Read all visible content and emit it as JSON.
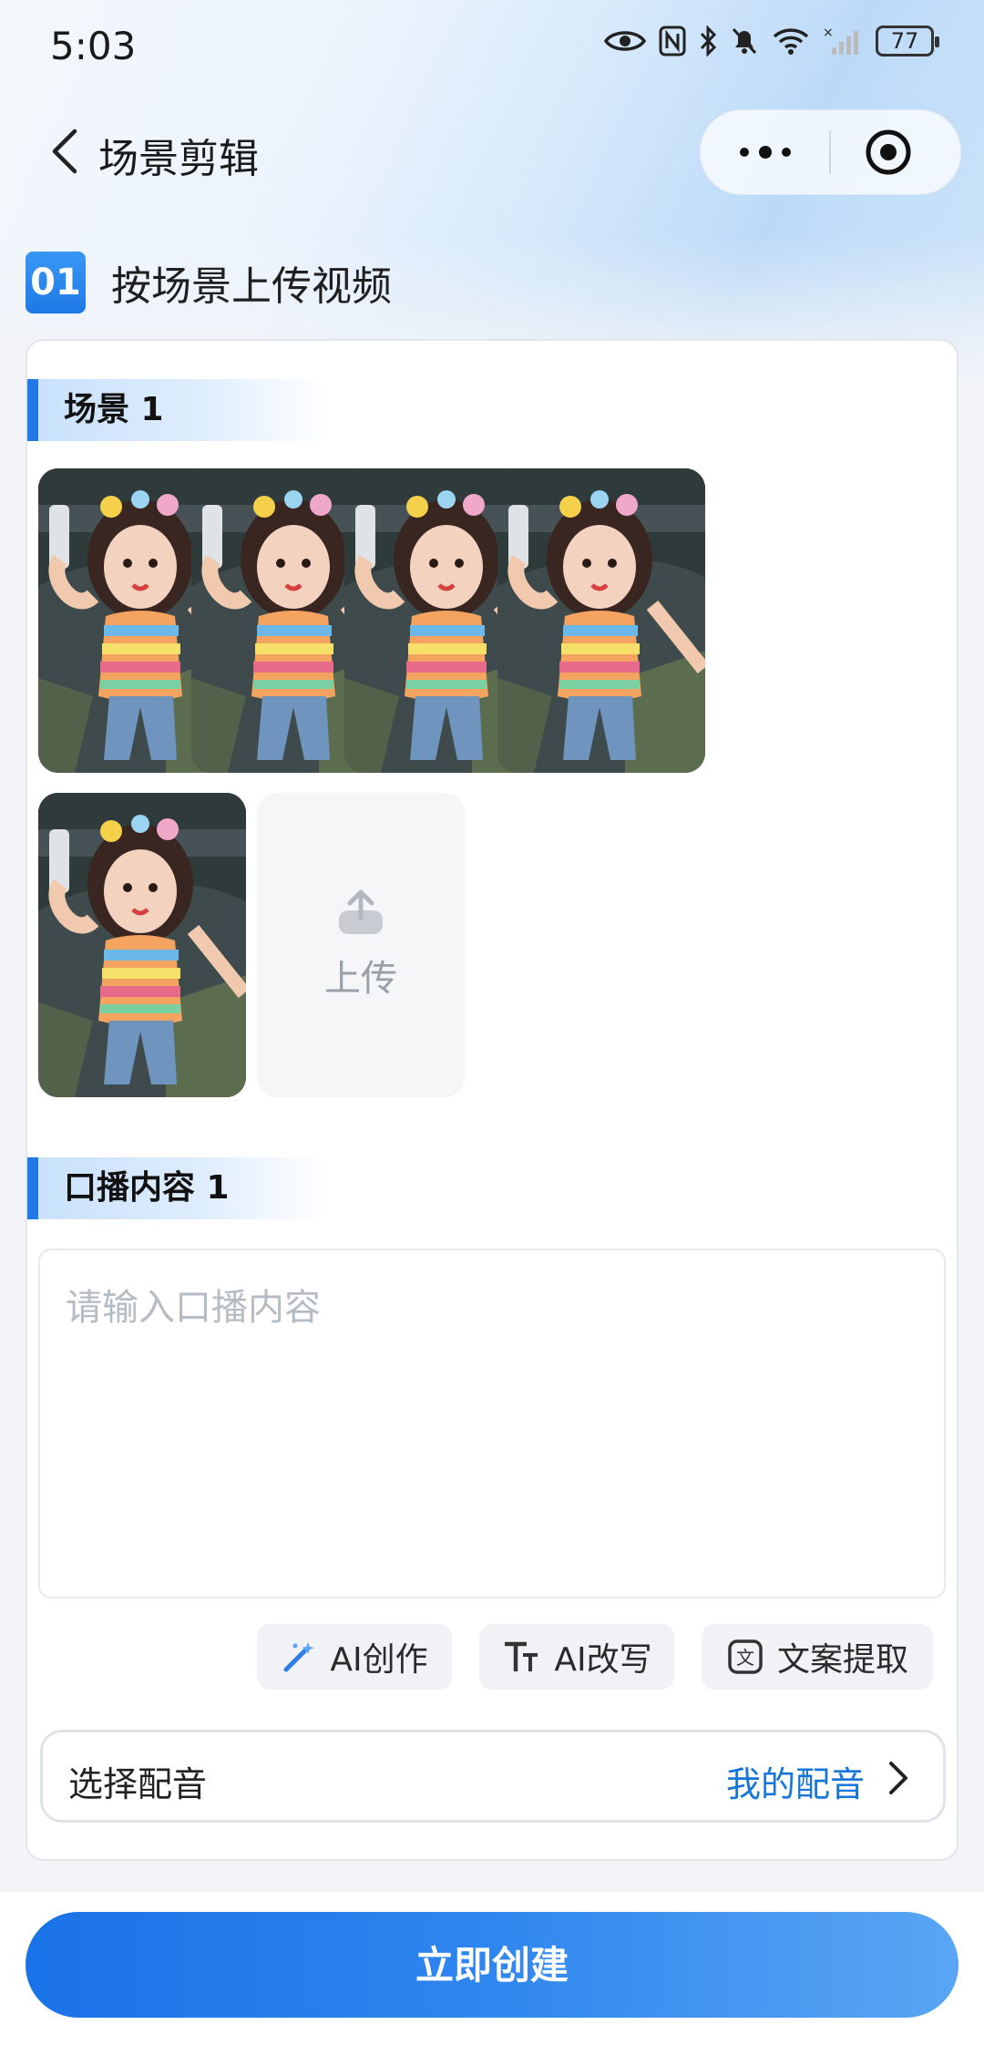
{
  "status_bar": {
    "time": "5:03",
    "battery": "77"
  },
  "nav": {
    "title": "场景剪辑"
  },
  "section": {
    "number": "01",
    "title": "按场景上传视频"
  },
  "scene": {
    "label": "场景 1",
    "thumbnail_count": 5,
    "upload_label": "上传"
  },
  "script_section": {
    "label": "口播内容 1",
    "placeholder": "请输入口播内容"
  },
  "ai_buttons": [
    {
      "label": "AI创作",
      "icon": "magic-wand-icon"
    },
    {
      "label": "AI改写",
      "icon": "text-size-icon"
    },
    {
      "label": "文案提取",
      "icon": "extract-text-icon"
    }
  ],
  "voice": {
    "label": "选择配音",
    "link": "我的配音"
  },
  "create_button": "立即创建",
  "colors": {
    "accent": "#1f78e6",
    "link": "#1675d9",
    "button_start": "#1a72e8",
    "button_end": "#5aa6f4"
  }
}
